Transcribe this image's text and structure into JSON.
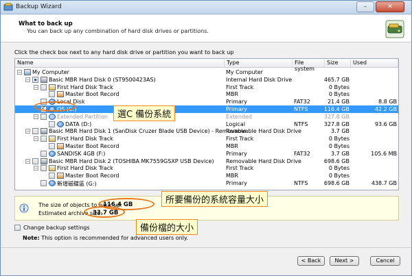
{
  "window": {
    "title": "Backup Wizard",
    "close_label": "✕",
    "min_label": "–"
  },
  "header": {
    "title": "What to back up",
    "subtitle": "You can back up any combination of hard disk drives or partitions."
  },
  "instruction": "Click the check box next to any hard disk drive or partition you want to back up",
  "table": {
    "columns": [
      "Name",
      "Type",
      "File system",
      "Size",
      "Used"
    ],
    "rows": [
      {
        "name": "My Computer",
        "type": "My Computer",
        "fs": "",
        "size": "",
        "used": "",
        "level": 0,
        "icon": "computer-icon",
        "check": "none",
        "expander": "-"
      },
      {
        "name": "Basic MBR Hard Disk 0 (ST9500423AS)",
        "type": "Internal Hard Disk Drive",
        "fs": "",
        "size": "465.7 GB",
        "used": "",
        "level": 1,
        "icon": "hard-disk-icon",
        "check": "partial",
        "expander": "-"
      },
      {
        "name": "First Hard Disk Track",
        "type": "First Track",
        "fs": "",
        "size": "0 Bytes",
        "used": "",
        "level": 2,
        "icon": "track-icon",
        "check": "empty",
        "expander": "-"
      },
      {
        "name": "Master Boot Record",
        "type": "MBR",
        "fs": "",
        "size": "0 Bytes",
        "used": "",
        "level": 3,
        "icon": "mbr-icon",
        "check": "empty",
        "expander": ""
      },
      {
        "name": "Local Disk",
        "type": "Primary",
        "fs": "FAT32",
        "size": "21.4 GB",
        "used": "8.8 GB",
        "level": 2,
        "icon": "partition-icon",
        "check": "empty",
        "expander": ""
      },
      {
        "name": "OS (C:)",
        "type": "Primary",
        "fs": "NTFS",
        "size": "116.4 GB",
        "used": "42.2 GB",
        "level": 2,
        "icon": "partition-icon",
        "check": "checked",
        "expander": "",
        "selected": true
      },
      {
        "name": "Extended Partition",
        "type": "Extended",
        "fs": "",
        "size": "327.8 GB",
        "used": "",
        "level": 2,
        "icon": "extended-partition-icon",
        "check": "empty",
        "expander": "-",
        "extended": true
      },
      {
        "name": "DATA (D:)",
        "type": "Logical",
        "fs": "NTFS",
        "size": "327.8 GB",
        "used": "93.6 GB",
        "level": 3,
        "icon": "partition-icon",
        "check": "empty",
        "expander": ""
      },
      {
        "name": "Basic MBR Hard Disk 1 (SanDisk Cruzer Blade USB Device) - Removable",
        "type": "Removable Hard Disk Drive",
        "fs": "",
        "size": "3.7 GB",
        "used": "",
        "level": 1,
        "icon": "hard-disk-icon",
        "check": "empty",
        "expander": "-"
      },
      {
        "name": "First Hard Disk Track",
        "type": "First Track",
        "fs": "",
        "size": "0 Bytes",
        "used": "",
        "level": 2,
        "icon": "track-icon",
        "check": "empty",
        "expander": "-"
      },
      {
        "name": "Master Boot Record",
        "type": "MBR",
        "fs": "",
        "size": "0 Bytes",
        "used": "",
        "level": 3,
        "icon": "mbr-icon",
        "check": "empty",
        "expander": ""
      },
      {
        "name": "SANDISK 4GB (F:)",
        "type": "Primary",
        "fs": "FAT32",
        "size": "3.7 GB",
        "used": "105.6 MB",
        "level": 2,
        "icon": "partition-icon",
        "check": "empty",
        "expander": ""
      },
      {
        "name": "Basic MBR Hard Disk 2 (TOSHIBA MK7559GSXP USB Device)",
        "type": "Removable Hard Disk Drive",
        "fs": "",
        "size": "698.6 GB",
        "used": "",
        "level": 1,
        "icon": "hard-disk-icon",
        "check": "empty",
        "expander": "-"
      },
      {
        "name": "First Hard Disk Track",
        "type": "First Track",
        "fs": "",
        "size": "0 Bytes",
        "used": "",
        "level": 2,
        "icon": "track-icon",
        "check": "empty",
        "expander": "-"
      },
      {
        "name": "Master Boot Record",
        "type": "MBR",
        "fs": "",
        "size": "0 Bytes",
        "used": "",
        "level": 3,
        "icon": "mbr-icon",
        "check": "empty",
        "expander": ""
      },
      {
        "name": "新增磁碟區 (G:)",
        "type": "Primary",
        "fs": "NTFS",
        "size": "698.6 GB",
        "used": "438.7 GB",
        "level": 2,
        "icon": "partition-icon",
        "check": "empty",
        "expander": ""
      }
    ]
  },
  "info": {
    "size_label": "The size of objects to back up:",
    "size_value": "116.4 GB",
    "archive_label": "Estimated archive size:",
    "archive_value": "33.7 GB"
  },
  "annotations": {
    "select_c": "選C 備份系統",
    "system_size": "所要備份的系統容量大小",
    "archive_size": "備份檔的大小"
  },
  "options": {
    "change_settings": "Change backup settings",
    "note_prefix": "Note:",
    "note_text": "This option is recommended for advanced users only."
  },
  "buttons": {
    "back": "< Back",
    "next": "Next >",
    "cancel": "Cancel"
  },
  "colors": {
    "selection": "#3399ff",
    "callout_border": "#f08a20",
    "callout_bg": "#ffffcc",
    "info_bg": "#ffffe6"
  }
}
